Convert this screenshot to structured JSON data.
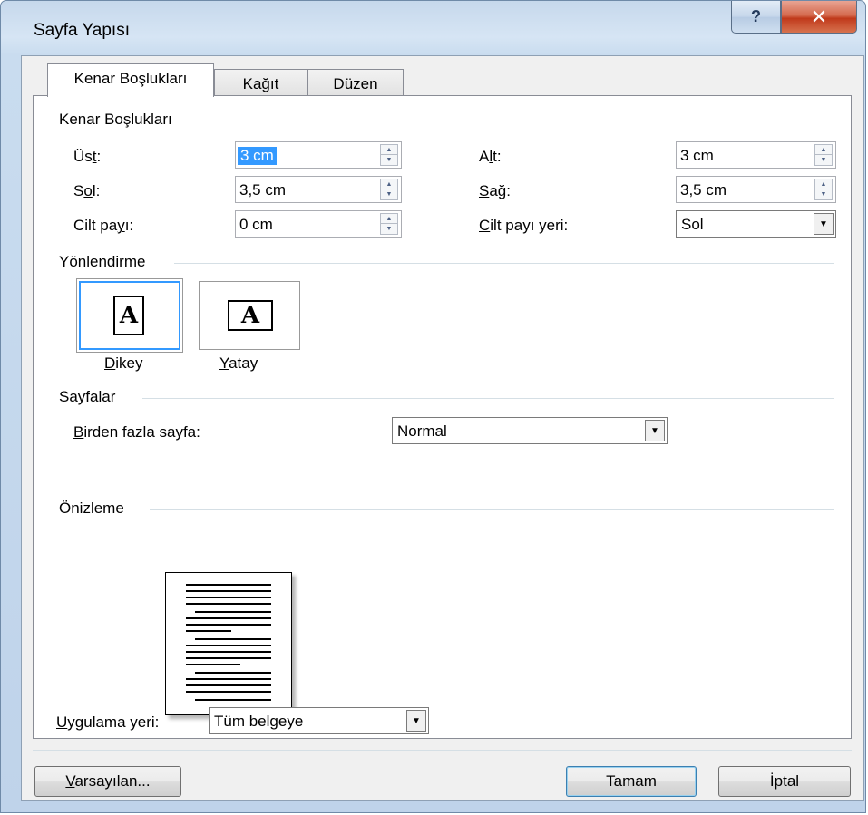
{
  "window": {
    "title": "Sayfa Yapısı",
    "help_glyph": "?",
    "close_glyph": "✕"
  },
  "tabs": [
    {
      "label": "Kenar Boşlukları",
      "active": true
    },
    {
      "label": "Kağıt",
      "active": false
    },
    {
      "label": "Düzen",
      "active": false
    }
  ],
  "margins": {
    "group_title": "Kenar Boşlukları",
    "top": {
      "label": "Üst:",
      "value": "3 cm"
    },
    "bottom": {
      "label": "Alt:",
      "value": "3 cm"
    },
    "left": {
      "label": "Sol:",
      "value": "3,5 cm"
    },
    "right": {
      "label": "Sağ:",
      "value": "3,5 cm"
    },
    "gutter": {
      "label": "Cilt payı:",
      "value": "0 cm"
    },
    "gutter_position": {
      "label": "Cilt payı yeri:",
      "value": "Sol"
    }
  },
  "orientation": {
    "group_title": "Yönlendirme",
    "portrait_label": "Dikey",
    "landscape_label": "Yatay",
    "glyph": "A",
    "selected": "portrait"
  },
  "pages": {
    "group_title": "Sayfalar",
    "multiple_label": "Birden fazla sayfa:",
    "multiple_value": "Normal"
  },
  "preview": {
    "group_title": "Önizleme"
  },
  "apply_to": {
    "label": "Uygulama yeri:",
    "value": "Tüm belgeye"
  },
  "buttons": {
    "default": "Varsayılan...",
    "ok": "Tamam",
    "cancel": "İptal"
  },
  "icons": {
    "spin_up": "up-arrow-icon",
    "spin_down": "down-arrow-icon",
    "dropdown": "dropdown-arrow-icon"
  }
}
